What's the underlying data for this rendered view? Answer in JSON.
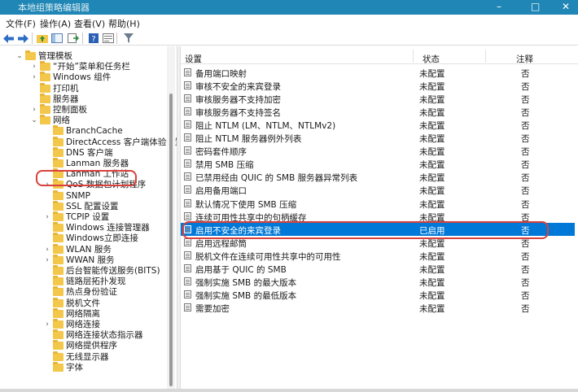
{
  "window": {
    "title": "本地组策略编辑器",
    "controls": [
      "–",
      "□",
      "✕"
    ]
  },
  "menu": [
    "文件(F)",
    "操作(A)",
    "查看(V)",
    "帮助(H)"
  ],
  "toolbar": [
    "arrow-left-icon",
    "arrow-right-icon",
    "folder-up-icon",
    "show-hide-tree-icon",
    "export-list-icon",
    "help-icon",
    "properties-icon",
    "filter-icon"
  ],
  "tree": [
    {
      "label": "管理模板",
      "depth": 0,
      "exp": "v"
    },
    {
      "label": "“开始”菜单和任务栏",
      "depth": 1,
      "exp": ">"
    },
    {
      "label": "Windows 组件",
      "depth": 1,
      "exp": ">"
    },
    {
      "label": "打印机",
      "depth": 1,
      "exp": ""
    },
    {
      "label": "服务器",
      "depth": 1,
      "exp": ""
    },
    {
      "label": "控制面板",
      "depth": 1,
      "exp": ">"
    },
    {
      "label": "网络",
      "depth": 1,
      "exp": "v"
    },
    {
      "label": "BranchCache",
      "depth": 2,
      "exp": ""
    },
    {
      "label": "DirectAccess 客户端体验设置",
      "depth": 2,
      "exp": ""
    },
    {
      "label": "DNS 客户端",
      "depth": 2,
      "exp": ""
    },
    {
      "label": "Lanman 服务器",
      "depth": 2,
      "exp": ""
    },
    {
      "label": "Lanman 工作站",
      "depth": 2,
      "exp": ""
    },
    {
      "label": "QoS 数据包计划程序",
      "depth": 2,
      "exp": ">"
    },
    {
      "label": "SNMP",
      "depth": 2,
      "exp": ""
    },
    {
      "label": "SSL 配置设置",
      "depth": 2,
      "exp": ""
    },
    {
      "label": "TCPIP 设置",
      "depth": 2,
      "exp": ">"
    },
    {
      "label": "Windows 连接管理器",
      "depth": 2,
      "exp": ""
    },
    {
      "label": "Windows立即连接",
      "depth": 2,
      "exp": ""
    },
    {
      "label": "WLAN 服务",
      "depth": 2,
      "exp": ">"
    },
    {
      "label": "WWAN 服务",
      "depth": 2,
      "exp": ">"
    },
    {
      "label": "后台智能传送服务(BITS)",
      "depth": 2,
      "exp": ""
    },
    {
      "label": "链路层拓扑发现",
      "depth": 2,
      "exp": ""
    },
    {
      "label": "热点身份验证",
      "depth": 2,
      "exp": ""
    },
    {
      "label": "脱机文件",
      "depth": 2,
      "exp": ""
    },
    {
      "label": "网络隔离",
      "depth": 2,
      "exp": ""
    },
    {
      "label": "网络连接",
      "depth": 2,
      "exp": ">"
    },
    {
      "label": "网络连接状态指示器",
      "depth": 2,
      "exp": ""
    },
    {
      "label": "网络提供程序",
      "depth": 2,
      "exp": ""
    },
    {
      "label": "无线显示器",
      "depth": 2,
      "exp": ""
    },
    {
      "label": "字体",
      "depth": 2,
      "exp": ""
    }
  ],
  "columns": {
    "setting": "设置",
    "state": "状态",
    "comment": "注释"
  },
  "rows": [
    {
      "setting": "备用端口映射",
      "state": "未配置",
      "comment": "否"
    },
    {
      "setting": "审核不安全的来宾登录",
      "state": "未配置",
      "comment": "否"
    },
    {
      "setting": "审核服务器不支持加密",
      "state": "未配置",
      "comment": "否"
    },
    {
      "setting": "审核服务器不支持签名",
      "state": "未配置",
      "comment": "否"
    },
    {
      "setting": "阻止 NTLM (LM、NTLM、NTLMv2)",
      "state": "未配置",
      "comment": "否"
    },
    {
      "setting": "阻止 NTLM 服务器例外列表",
      "state": "未配置",
      "comment": "否"
    },
    {
      "setting": "密码套件顺序",
      "state": "未配置",
      "comment": "否"
    },
    {
      "setting": "禁用 SMB 压缩",
      "state": "未配置",
      "comment": "否"
    },
    {
      "setting": "已禁用经由 QUIC 的 SMB 服务器异常列表",
      "state": "未配置",
      "comment": "否"
    },
    {
      "setting": "启用备用端口",
      "state": "未配置",
      "comment": "否"
    },
    {
      "setting": "默认情况下使用 SMB 压缩",
      "state": "未配置",
      "comment": "否"
    },
    {
      "setting": "连续可用性共享中的句柄缓存",
      "state": "未配置",
      "comment": "否"
    },
    {
      "setting": "启用不安全的来宾登录",
      "state": "已启用",
      "comment": "否"
    },
    {
      "setting": "启用远程邮筒",
      "state": "未配置",
      "comment": "否"
    },
    {
      "setting": "脱机文件在连续可用性共享中的可用性",
      "state": "未配置",
      "comment": "否"
    },
    {
      "setting": "启用基于 QUIC 的 SMB",
      "state": "未配置",
      "comment": "否"
    },
    {
      "setting": "强制实施 SMB 的最大版本",
      "state": "未配置",
      "comment": "否"
    },
    {
      "setting": "强制实施 SMB 的最低版本",
      "state": "未配置",
      "comment": "否"
    },
    {
      "setting": "需要加密",
      "state": "未配置",
      "comment": "否"
    }
  ],
  "selected_row_index": 12,
  "highlighted_tree_index": 11,
  "colors": {
    "titlebar": "#1f86b5",
    "selection": "#0078d7",
    "annotation": "#d9413c",
    "folder": "#f3c74a"
  }
}
